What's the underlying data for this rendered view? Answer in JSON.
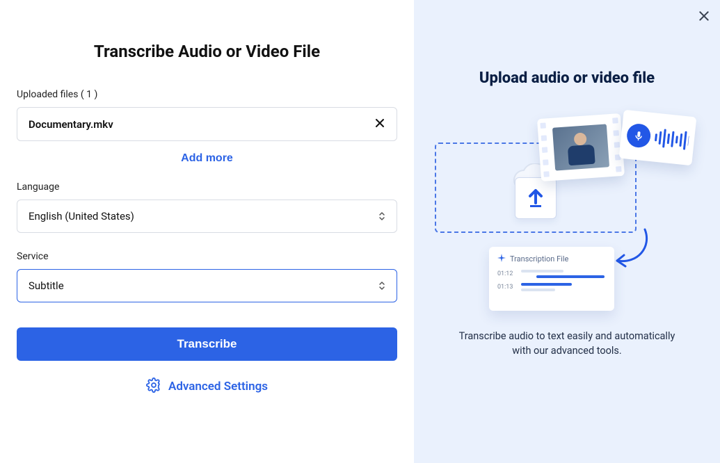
{
  "left": {
    "title": "Transcribe Audio or Video File",
    "uploaded_label": "Uploaded files ( 1 )",
    "file_name": "Documentary.mkv",
    "add_more": "Add more",
    "language_label": "Language",
    "language_value": "English (United States)",
    "service_label": "Service",
    "service_value": "Subtitle",
    "transcribe_button": "Transcribe",
    "advanced_settings": "Advanced Settings"
  },
  "right": {
    "title": "Upload audio or video file",
    "description": "Transcribe audio to text easily and automatically with our advanced tools.",
    "trans_card_title": "Transcription File",
    "ts1": "01:12",
    "ts2": "01:13"
  },
  "colors": {
    "accent": "#2c63e5",
    "right_bg": "#eaf1fd"
  }
}
